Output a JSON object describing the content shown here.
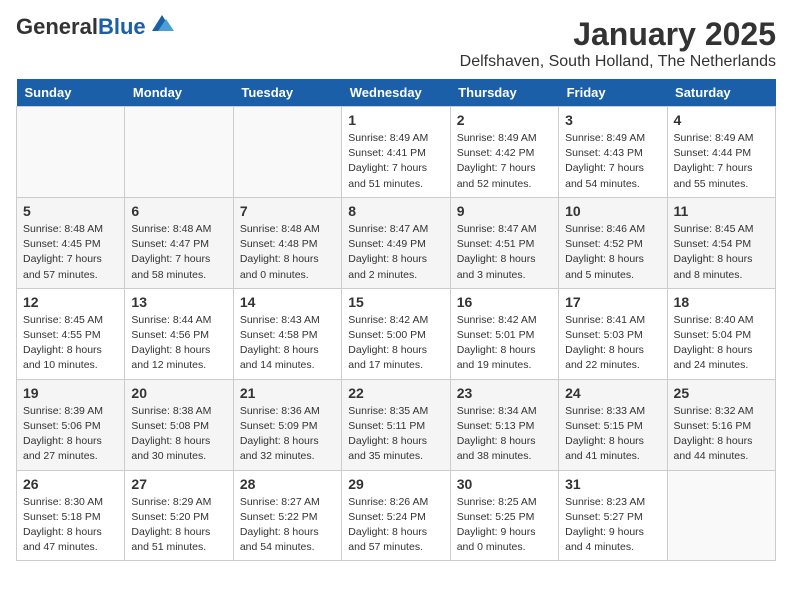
{
  "header": {
    "logo_general": "General",
    "logo_blue": "Blue",
    "title": "January 2025",
    "subtitle": "Delfshaven, South Holland, The Netherlands"
  },
  "days_of_week": [
    "Sunday",
    "Monday",
    "Tuesday",
    "Wednesday",
    "Thursday",
    "Friday",
    "Saturday"
  ],
  "weeks": [
    [
      {
        "day": "",
        "info": ""
      },
      {
        "day": "",
        "info": ""
      },
      {
        "day": "",
        "info": ""
      },
      {
        "day": "1",
        "info": "Sunrise: 8:49 AM\nSunset: 4:41 PM\nDaylight: 7 hours\nand 51 minutes."
      },
      {
        "day": "2",
        "info": "Sunrise: 8:49 AM\nSunset: 4:42 PM\nDaylight: 7 hours\nand 52 minutes."
      },
      {
        "day": "3",
        "info": "Sunrise: 8:49 AM\nSunset: 4:43 PM\nDaylight: 7 hours\nand 54 minutes."
      },
      {
        "day": "4",
        "info": "Sunrise: 8:49 AM\nSunset: 4:44 PM\nDaylight: 7 hours\nand 55 minutes."
      }
    ],
    [
      {
        "day": "5",
        "info": "Sunrise: 8:48 AM\nSunset: 4:45 PM\nDaylight: 7 hours\nand 57 minutes."
      },
      {
        "day": "6",
        "info": "Sunrise: 8:48 AM\nSunset: 4:47 PM\nDaylight: 7 hours\nand 58 minutes."
      },
      {
        "day": "7",
        "info": "Sunrise: 8:48 AM\nSunset: 4:48 PM\nDaylight: 8 hours\nand 0 minutes."
      },
      {
        "day": "8",
        "info": "Sunrise: 8:47 AM\nSunset: 4:49 PM\nDaylight: 8 hours\nand 2 minutes."
      },
      {
        "day": "9",
        "info": "Sunrise: 8:47 AM\nSunset: 4:51 PM\nDaylight: 8 hours\nand 3 minutes."
      },
      {
        "day": "10",
        "info": "Sunrise: 8:46 AM\nSunset: 4:52 PM\nDaylight: 8 hours\nand 5 minutes."
      },
      {
        "day": "11",
        "info": "Sunrise: 8:45 AM\nSunset: 4:54 PM\nDaylight: 8 hours\nand 8 minutes."
      }
    ],
    [
      {
        "day": "12",
        "info": "Sunrise: 8:45 AM\nSunset: 4:55 PM\nDaylight: 8 hours\nand 10 minutes."
      },
      {
        "day": "13",
        "info": "Sunrise: 8:44 AM\nSunset: 4:56 PM\nDaylight: 8 hours\nand 12 minutes."
      },
      {
        "day": "14",
        "info": "Sunrise: 8:43 AM\nSunset: 4:58 PM\nDaylight: 8 hours\nand 14 minutes."
      },
      {
        "day": "15",
        "info": "Sunrise: 8:42 AM\nSunset: 5:00 PM\nDaylight: 8 hours\nand 17 minutes."
      },
      {
        "day": "16",
        "info": "Sunrise: 8:42 AM\nSunset: 5:01 PM\nDaylight: 8 hours\nand 19 minutes."
      },
      {
        "day": "17",
        "info": "Sunrise: 8:41 AM\nSunset: 5:03 PM\nDaylight: 8 hours\nand 22 minutes."
      },
      {
        "day": "18",
        "info": "Sunrise: 8:40 AM\nSunset: 5:04 PM\nDaylight: 8 hours\nand 24 minutes."
      }
    ],
    [
      {
        "day": "19",
        "info": "Sunrise: 8:39 AM\nSunset: 5:06 PM\nDaylight: 8 hours\nand 27 minutes."
      },
      {
        "day": "20",
        "info": "Sunrise: 8:38 AM\nSunset: 5:08 PM\nDaylight: 8 hours\nand 30 minutes."
      },
      {
        "day": "21",
        "info": "Sunrise: 8:36 AM\nSunset: 5:09 PM\nDaylight: 8 hours\nand 32 minutes."
      },
      {
        "day": "22",
        "info": "Sunrise: 8:35 AM\nSunset: 5:11 PM\nDaylight: 8 hours\nand 35 minutes."
      },
      {
        "day": "23",
        "info": "Sunrise: 8:34 AM\nSunset: 5:13 PM\nDaylight: 8 hours\nand 38 minutes."
      },
      {
        "day": "24",
        "info": "Sunrise: 8:33 AM\nSunset: 5:15 PM\nDaylight: 8 hours\nand 41 minutes."
      },
      {
        "day": "25",
        "info": "Sunrise: 8:32 AM\nSunset: 5:16 PM\nDaylight: 8 hours\nand 44 minutes."
      }
    ],
    [
      {
        "day": "26",
        "info": "Sunrise: 8:30 AM\nSunset: 5:18 PM\nDaylight: 8 hours\nand 47 minutes."
      },
      {
        "day": "27",
        "info": "Sunrise: 8:29 AM\nSunset: 5:20 PM\nDaylight: 8 hours\nand 51 minutes."
      },
      {
        "day": "28",
        "info": "Sunrise: 8:27 AM\nSunset: 5:22 PM\nDaylight: 8 hours\nand 54 minutes."
      },
      {
        "day": "29",
        "info": "Sunrise: 8:26 AM\nSunset: 5:24 PM\nDaylight: 8 hours\nand 57 minutes."
      },
      {
        "day": "30",
        "info": "Sunrise: 8:25 AM\nSunset: 5:25 PM\nDaylight: 9 hours\nand 0 minutes."
      },
      {
        "day": "31",
        "info": "Sunrise: 8:23 AM\nSunset: 5:27 PM\nDaylight: 9 hours\nand 4 minutes."
      },
      {
        "day": "",
        "info": ""
      }
    ]
  ]
}
